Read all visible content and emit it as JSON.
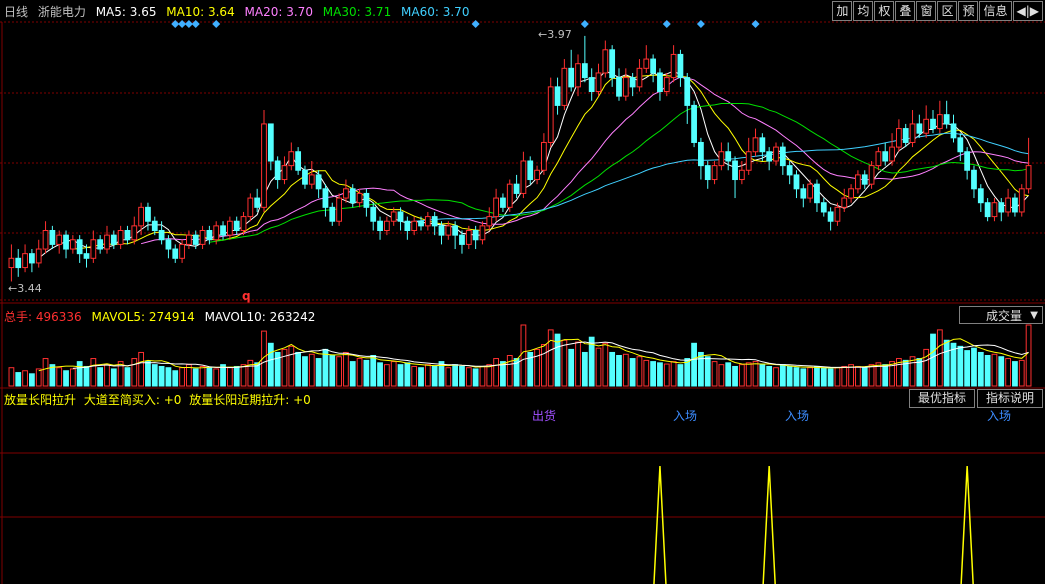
{
  "header": {
    "period": "日线",
    "stock": "浙能电力",
    "ma5": "MA5: 3.65",
    "ma10": "MA10: 3.64",
    "ma20": "MA20: 3.70",
    "ma30": "MA30: 3.71",
    "ma60": "MA60: 3.70"
  },
  "toolbar": [
    "加",
    "均",
    "权",
    "叠",
    "窗",
    "区",
    "预",
    "信息",
    "◀|▶"
  ],
  "volume_panel": {
    "total": "总手: 496336",
    "mavol5": "MAVOL5: 274914",
    "mavol10": "MAVOL10: 263242",
    "selector": "成交量"
  },
  "indicator_panel": {
    "name": "放量长阳拉升",
    "line1": "大道至简买入: +0",
    "line2": "放量长阳近期拉升: +0",
    "best_button": "最优指标",
    "help_button": "指标说明",
    "signals": [
      {
        "label": "出货",
        "color": "#a050ff"
      },
      {
        "label": "入场",
        "color": "#3c8cff"
      },
      {
        "label": "入场",
        "color": "#3c8cff"
      },
      {
        "label": "入场",
        "color": "#3c8cff"
      }
    ]
  },
  "colors": {
    "up": "#ff3030",
    "down": "#54ffff",
    "ma5": "#ffffff",
    "ma10": "#ffff00",
    "ma20": "#ff80ff",
    "ma30": "#00e000",
    "ma60": "#40d0ff",
    "grid": "#800000"
  },
  "chart_data": {
    "type": "candlestick",
    "price_labels": {
      "high": "3.97",
      "low": "3.44",
      "marker": "q"
    },
    "ylim": [
      3.4,
      4.0
    ],
    "candles": [
      [
        3.47,
        3.49,
        3.52,
        3.44
      ],
      [
        3.49,
        3.47,
        3.51,
        3.45
      ],
      [
        3.47,
        3.5,
        3.52,
        3.46
      ],
      [
        3.5,
        3.48,
        3.51,
        3.46
      ],
      [
        3.48,
        3.51,
        3.53,
        3.47
      ],
      [
        3.51,
        3.55,
        3.57,
        3.5
      ],
      [
        3.55,
        3.52,
        3.56,
        3.51
      ],
      [
        3.52,
        3.54,
        3.55,
        3.5
      ],
      [
        3.54,
        3.51,
        3.55,
        3.49
      ],
      [
        3.51,
        3.53,
        3.54,
        3.5
      ],
      [
        3.53,
        3.5,
        3.54,
        3.48
      ],
      [
        3.5,
        3.49,
        3.52,
        3.47
      ],
      [
        3.49,
        3.53,
        3.55,
        3.48
      ],
      [
        3.53,
        3.51,
        3.54,
        3.5
      ],
      [
        3.51,
        3.54,
        3.56,
        3.5
      ],
      [
        3.54,
        3.52,
        3.55,
        3.51
      ],
      [
        3.52,
        3.55,
        3.56,
        3.51
      ],
      [
        3.55,
        3.53,
        3.56,
        3.52
      ],
      [
        3.53,
        3.56,
        3.58,
        3.52
      ],
      [
        3.56,
        3.6,
        3.61,
        3.54
      ],
      [
        3.6,
        3.57,
        3.61,
        3.55
      ],
      [
        3.57,
        3.55,
        3.58,
        3.54
      ],
      [
        3.55,
        3.53,
        3.57,
        3.52
      ],
      [
        3.53,
        3.51,
        3.54,
        3.49
      ],
      [
        3.51,
        3.49,
        3.52,
        3.48
      ],
      [
        3.49,
        3.52,
        3.53,
        3.48
      ],
      [
        3.52,
        3.54,
        3.55,
        3.51
      ],
      [
        3.54,
        3.52,
        3.55,
        3.51
      ],
      [
        3.52,
        3.55,
        3.56,
        3.51
      ],
      [
        3.55,
        3.53,
        3.56,
        3.52
      ],
      [
        3.53,
        3.56,
        3.57,
        3.52
      ],
      [
        3.56,
        3.54,
        3.57,
        3.53
      ],
      [
        3.54,
        3.57,
        3.58,
        3.53
      ],
      [
        3.57,
        3.55,
        3.58,
        3.54
      ],
      [
        3.55,
        3.58,
        3.59,
        3.54
      ],
      [
        3.58,
        3.62,
        3.63,
        3.57
      ],
      [
        3.62,
        3.6,
        3.64,
        3.59
      ],
      [
        3.6,
        3.78,
        3.81,
        3.59
      ],
      [
        3.78,
        3.7,
        3.78,
        3.68
      ],
      [
        3.7,
        3.66,
        3.71,
        3.64
      ],
      [
        3.66,
        3.69,
        3.71,
        3.65
      ],
      [
        3.69,
        3.72,
        3.74,
        3.68
      ],
      [
        3.72,
        3.68,
        3.73,
        3.67
      ],
      [
        3.68,
        3.65,
        3.69,
        3.64
      ],
      [
        3.65,
        3.67,
        3.7,
        3.64
      ],
      [
        3.67,
        3.64,
        3.68,
        3.62
      ],
      [
        3.64,
        3.6,
        3.65,
        3.58
      ],
      [
        3.6,
        3.57,
        3.61,
        3.56
      ],
      [
        3.57,
        3.62,
        3.63,
        3.56
      ],
      [
        3.62,
        3.64,
        3.66,
        3.61
      ],
      [
        3.64,
        3.61,
        3.65,
        3.6
      ],
      [
        3.61,
        3.63,
        3.64,
        3.6
      ],
      [
        3.63,
        3.6,
        3.64,
        3.58
      ],
      [
        3.6,
        3.57,
        3.61,
        3.55
      ],
      [
        3.57,
        3.55,
        3.58,
        3.53
      ],
      [
        3.55,
        3.57,
        3.58,
        3.54
      ],
      [
        3.57,
        3.59,
        3.6,
        3.56
      ],
      [
        3.59,
        3.57,
        3.6,
        3.55
      ],
      [
        3.57,
        3.55,
        3.58,
        3.53
      ],
      [
        3.55,
        3.57,
        3.58,
        3.54
      ],
      [
        3.57,
        3.56,
        3.58,
        3.55
      ],
      [
        3.56,
        3.58,
        3.59,
        3.55
      ],
      [
        3.58,
        3.56,
        3.59,
        3.54
      ],
      [
        3.56,
        3.54,
        3.57,
        3.52
      ],
      [
        3.54,
        3.56,
        3.57,
        3.53
      ],
      [
        3.56,
        3.54,
        3.57,
        3.51
      ],
      [
        3.54,
        3.52,
        3.55,
        3.5
      ],
      [
        3.52,
        3.55,
        3.56,
        3.51
      ],
      [
        3.55,
        3.53,
        3.56,
        3.51
      ],
      [
        3.53,
        3.56,
        3.57,
        3.52
      ],
      [
        3.56,
        3.58,
        3.6,
        3.55
      ],
      [
        3.58,
        3.62,
        3.64,
        3.57
      ],
      [
        3.62,
        3.6,
        3.63,
        3.59
      ],
      [
        3.6,
        3.65,
        3.66,
        3.59
      ],
      [
        3.65,
        3.63,
        3.67,
        3.62
      ],
      [
        3.63,
        3.7,
        3.72,
        3.62
      ],
      [
        3.7,
        3.66,
        3.71,
        3.65
      ],
      [
        3.66,
        3.68,
        3.69,
        3.65
      ],
      [
        3.68,
        3.74,
        3.76,
        3.67
      ],
      [
        3.74,
        3.86,
        3.88,
        3.73
      ],
      [
        3.86,
        3.82,
        3.88,
        3.8
      ],
      [
        3.82,
        3.9,
        3.92,
        3.81
      ],
      [
        3.9,
        3.86,
        3.94,
        3.85
      ],
      [
        3.86,
        3.91,
        3.93,
        3.84
      ],
      [
        3.91,
        3.88,
        3.97,
        3.87
      ],
      [
        3.88,
        3.85,
        3.9,
        3.83
      ],
      [
        3.85,
        3.89,
        3.91,
        3.84
      ],
      [
        3.89,
        3.94,
        3.96,
        3.88
      ],
      [
        3.94,
        3.88,
        3.95,
        3.86
      ],
      [
        3.88,
        3.84,
        3.9,
        3.83
      ],
      [
        3.84,
        3.88,
        3.9,
        3.83
      ],
      [
        3.88,
        3.86,
        3.89,
        3.84
      ],
      [
        3.86,
        3.9,
        3.92,
        3.85
      ],
      [
        3.9,
        3.92,
        3.95,
        3.89
      ],
      [
        3.92,
        3.89,
        3.93,
        3.87
      ],
      [
        3.89,
        3.85,
        3.9,
        3.83
      ],
      [
        3.85,
        3.88,
        3.89,
        3.84
      ],
      [
        3.88,
        3.93,
        3.95,
        3.87
      ],
      [
        3.93,
        3.88,
        3.94,
        3.86
      ],
      [
        3.88,
        3.82,
        3.89,
        3.78
      ],
      [
        3.82,
        3.74,
        3.83,
        3.73
      ],
      [
        3.74,
        3.69,
        3.75,
        3.66
      ],
      [
        3.69,
        3.66,
        3.7,
        3.64
      ],
      [
        3.66,
        3.69,
        3.7,
        3.65
      ],
      [
        3.69,
        3.72,
        3.74,
        3.68
      ],
      [
        3.72,
        3.7,
        3.74,
        3.68
      ],
      [
        3.7,
        3.66,
        3.71,
        3.62
      ],
      [
        3.66,
        3.68,
        3.7,
        3.65
      ],
      [
        3.68,
        3.72,
        3.75,
        3.67
      ],
      [
        3.72,
        3.75,
        3.77,
        3.71
      ],
      [
        3.75,
        3.72,
        3.76,
        3.7
      ],
      [
        3.72,
        3.7,
        3.73,
        3.68
      ],
      [
        3.7,
        3.73,
        3.74,
        3.69
      ],
      [
        3.73,
        3.69,
        3.74,
        3.67
      ],
      [
        3.69,
        3.67,
        3.7,
        3.65
      ],
      [
        3.67,
        3.64,
        3.68,
        3.62
      ],
      [
        3.64,
        3.62,
        3.65,
        3.6
      ],
      [
        3.62,
        3.65,
        3.66,
        3.61
      ],
      [
        3.65,
        3.61,
        3.66,
        3.59
      ],
      [
        3.61,
        3.59,
        3.62,
        3.58
      ],
      [
        3.59,
        3.57,
        3.6,
        3.55
      ],
      [
        3.57,
        3.6,
        3.61,
        3.56
      ],
      [
        3.6,
        3.62,
        3.64,
        3.59
      ],
      [
        3.62,
        3.64,
        3.65,
        3.61
      ],
      [
        3.64,
        3.67,
        3.68,
        3.63
      ],
      [
        3.67,
        3.65,
        3.68,
        3.64
      ],
      [
        3.65,
        3.69,
        3.7,
        3.64
      ],
      [
        3.69,
        3.72,
        3.73,
        3.68
      ],
      [
        3.72,
        3.7,
        3.74,
        3.69
      ],
      [
        3.7,
        3.73,
        3.76,
        3.69
      ],
      [
        3.73,
        3.77,
        3.79,
        3.72
      ],
      [
        3.77,
        3.74,
        3.78,
        3.73
      ],
      [
        3.74,
        3.78,
        3.81,
        3.73
      ],
      [
        3.78,
        3.76,
        3.8,
        3.75
      ],
      [
        3.76,
        3.79,
        3.82,
        3.75
      ],
      [
        3.79,
        3.77,
        3.81,
        3.76
      ],
      [
        3.77,
        3.8,
        3.83,
        3.76
      ],
      [
        3.8,
        3.78,
        3.83,
        3.77
      ],
      [
        3.78,
        3.75,
        3.8,
        3.74
      ],
      [
        3.75,
        3.72,
        3.76,
        3.7
      ],
      [
        3.72,
        3.68,
        3.73,
        3.66
      ],
      [
        3.68,
        3.64,
        3.69,
        3.62
      ],
      [
        3.64,
        3.61,
        3.65,
        3.59
      ],
      [
        3.61,
        3.58,
        3.62,
        3.57
      ],
      [
        3.58,
        3.61,
        3.62,
        3.57
      ],
      [
        3.61,
        3.59,
        3.62,
        3.57
      ],
      [
        3.59,
        3.62,
        3.64,
        3.58
      ],
      [
        3.62,
        3.59,
        3.63,
        3.58
      ],
      [
        3.59,
        3.64,
        3.65,
        3.58
      ],
      [
        3.64,
        3.69,
        3.75,
        3.63
      ]
    ],
    "volumes": [
      0.3,
      0.22,
      0.25,
      0.2,
      0.28,
      0.45,
      0.35,
      0.3,
      0.25,
      0.28,
      0.4,
      0.32,
      0.45,
      0.3,
      0.35,
      0.28,
      0.4,
      0.3,
      0.45,
      0.55,
      0.4,
      0.35,
      0.32,
      0.3,
      0.25,
      0.3,
      0.35,
      0.28,
      0.32,
      0.3,
      0.28,
      0.35,
      0.3,
      0.32,
      0.35,
      0.42,
      0.38,
      0.9,
      0.7,
      0.55,
      0.6,
      0.65,
      0.55,
      0.48,
      0.52,
      0.45,
      0.6,
      0.5,
      0.48,
      0.55,
      0.4,
      0.45,
      0.42,
      0.5,
      0.38,
      0.35,
      0.4,
      0.35,
      0.38,
      0.32,
      0.3,
      0.35,
      0.32,
      0.4,
      0.3,
      0.35,
      0.32,
      0.3,
      0.28,
      0.32,
      0.35,
      0.45,
      0.4,
      0.5,
      0.45,
      1.0,
      0.55,
      0.6,
      0.68,
      0.92,
      0.85,
      0.75,
      0.6,
      0.72,
      0.55,
      0.8,
      0.62,
      0.7,
      0.55,
      0.5,
      0.52,
      0.45,
      0.48,
      0.42,
      0.4,
      0.38,
      0.36,
      0.4,
      0.35,
      0.45,
      0.7,
      0.55,
      0.48,
      0.4,
      0.35,
      0.38,
      0.32,
      0.35,
      0.38,
      0.4,
      0.35,
      0.32,
      0.3,
      0.35,
      0.32,
      0.3,
      0.28,
      0.3,
      0.32,
      0.3,
      0.28,
      0.3,
      0.32,
      0.35,
      0.32,
      0.3,
      0.35,
      0.38,
      0.35,
      0.4,
      0.45,
      0.42,
      0.48,
      0.45,
      0.6,
      0.85,
      0.92,
      0.75,
      0.7,
      0.65,
      0.58,
      0.62,
      0.55,
      0.5,
      0.52,
      0.48,
      0.45,
      0.4,
      0.42,
      1.0
    ],
    "diamond_markers": [
      24,
      25,
      26,
      27,
      30,
      68,
      84,
      96,
      101,
      109
    ],
    "signal_peaks": [
      95,
      111,
      140
    ]
  }
}
